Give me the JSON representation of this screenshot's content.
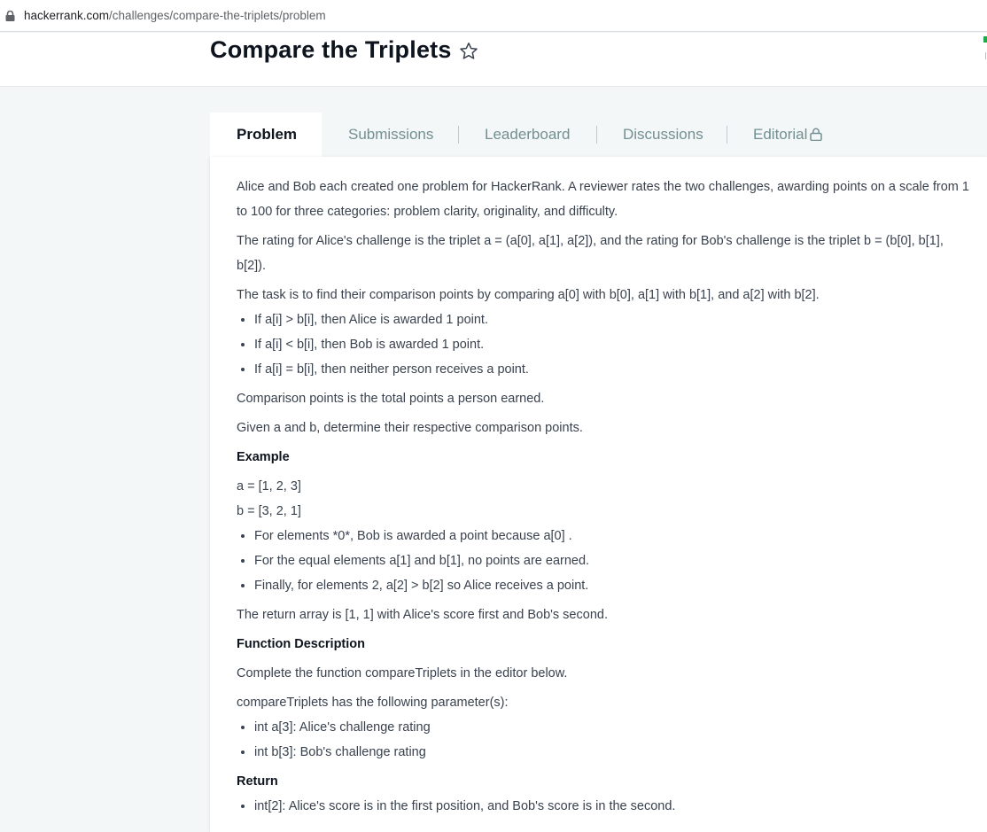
{
  "browser": {
    "url_host": "hackerrank.com",
    "url_path": "/challenges/compare-the-triplets/problem"
  },
  "header": {
    "title": "Compare the Triplets"
  },
  "tabs": [
    {
      "label": "Problem"
    },
    {
      "label": "Submissions"
    },
    {
      "label": "Leaderboard"
    },
    {
      "label": "Discussions"
    },
    {
      "label": "Editorial"
    }
  ],
  "problem": {
    "intro": "Alice and Bob each created one problem for HackerRank. A reviewer rates the two challenges, awarding points on a scale from 1 to 100 for three categories: problem clarity, originality, and difficulty.",
    "rating": "The rating for Alice's challenge is the triplet a = (a[0], a[1], a[2]), and the rating for Bob's challenge is the triplet b = (b[0], b[1], b[2]).",
    "task": "The task is to find their comparison points by comparing a[0] with b[0], a[1] with b[1], and a[2] with b[2].",
    "rules": [
      "If a[i] > b[i], then Alice is awarded 1 point.",
      "If a[i] < b[i], then Bob is awarded 1 point.",
      "If a[i] = b[i], then neither person receives a point."
    ],
    "comparison": "Comparison points is the total points a person earned.",
    "given": "Given a and b, determine their respective comparison points.",
    "example_heading": "Example",
    "example_a": "a = [1, 2, 3]",
    "example_b": "b = [3, 2, 1]",
    "example_points": [
      "For elements *0*, Bob is awarded a point because a[0] .",
      "For the equal elements a[1] and b[1], no points are earned.",
      "Finally, for elements 2, a[2] > b[2] so Alice receives a point."
    ],
    "return_array": "The return array is [1, 1] with Alice's score first and Bob's second.",
    "function_heading": "Function Description",
    "complete": "Complete the function compareTriplets in the editor below.",
    "params_intro": "compareTriplets has the following parameter(s):",
    "params": [
      "int a[3]: Alice's challenge rating",
      "int b[3]: Bob's challenge rating"
    ],
    "return_heading": "Return",
    "return_items": [
      "int[2]: Alice's score is in the first position, and Bob's score is in the second."
    ]
  },
  "colors": {
    "title": "#0e141e",
    "body_text": "#39424e",
    "tab_inactive": "#738f93",
    "page_bg": "#f3f7f7",
    "accent_green": "#1ba94c"
  },
  "icons": {
    "star": "star-outline-icon",
    "editorial_lock": "lock-icon",
    "url_lock": "lock-icon"
  }
}
